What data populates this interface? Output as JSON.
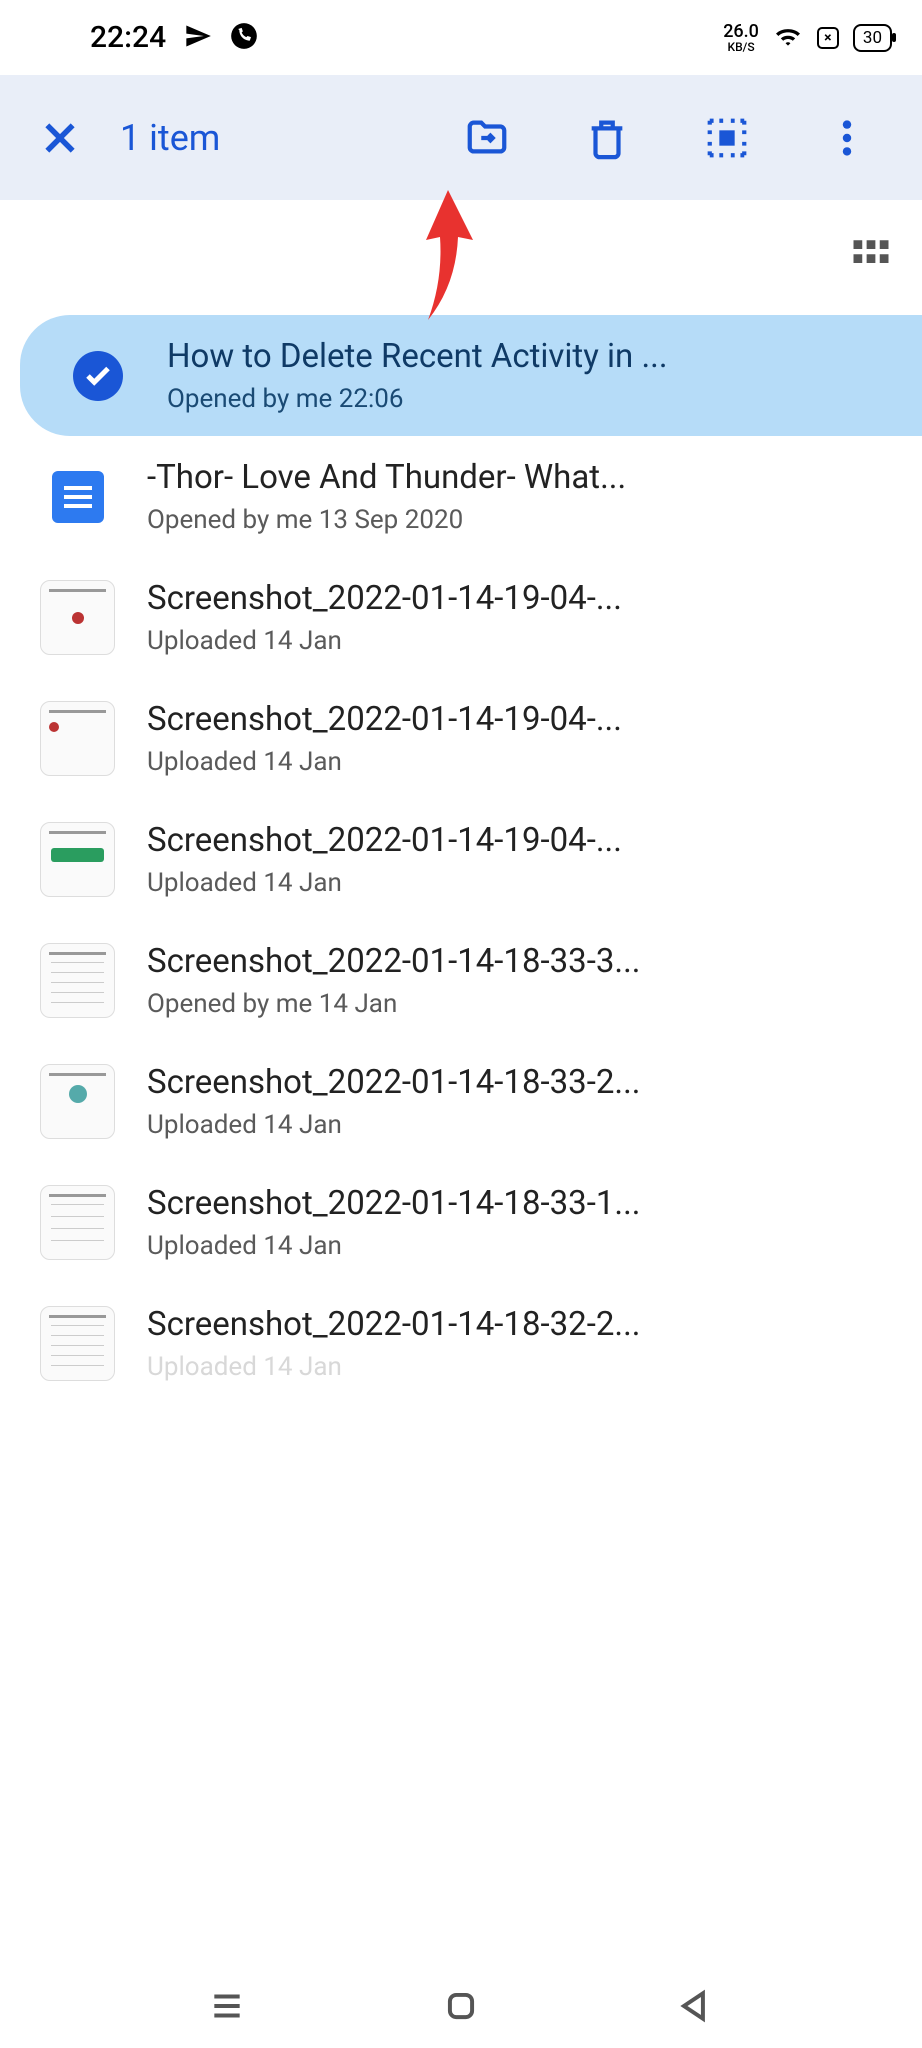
{
  "status": {
    "time": "22:24",
    "net_speed": "26.0",
    "net_unit": "KB/S",
    "battery": "30"
  },
  "toolbar": {
    "selection_count": "1 item"
  },
  "files": [
    {
      "title": "How to Delete Recent Activity in ...",
      "subtitle": "Opened by me 22:06",
      "type": "selected"
    },
    {
      "title": "-Thor- Love And Thunder- What...",
      "subtitle": "Opened by me 13 Sep 2020",
      "type": "doc"
    },
    {
      "title": "Screenshot_2022-01-14-19-04-...",
      "subtitle": "Uploaded 14 Jan",
      "type": "thumb",
      "tclass": "t1"
    },
    {
      "title": "Screenshot_2022-01-14-19-04-...",
      "subtitle": "Uploaded 14 Jan",
      "type": "thumb",
      "tclass": "t2"
    },
    {
      "title": "Screenshot_2022-01-14-19-04-...",
      "subtitle": "Uploaded 14 Jan",
      "type": "thumb",
      "tclass": "t3"
    },
    {
      "title": "Screenshot_2022-01-14-18-33-3...",
      "subtitle": "Opened by me 14 Jan",
      "type": "thumb",
      "tclass": "t4"
    },
    {
      "title": "Screenshot_2022-01-14-18-33-2...",
      "subtitle": "Uploaded 14 Jan",
      "type": "thumb",
      "tclass": "t5"
    },
    {
      "title": "Screenshot_2022-01-14-18-33-1...",
      "subtitle": "Uploaded 14 Jan",
      "type": "thumb",
      "tclass": "t6"
    },
    {
      "title": "Screenshot_2022-01-14-18-32-2...",
      "subtitle": "Uploaded 14 Jan",
      "type": "thumb",
      "tclass": "t4",
      "faded": true
    }
  ]
}
